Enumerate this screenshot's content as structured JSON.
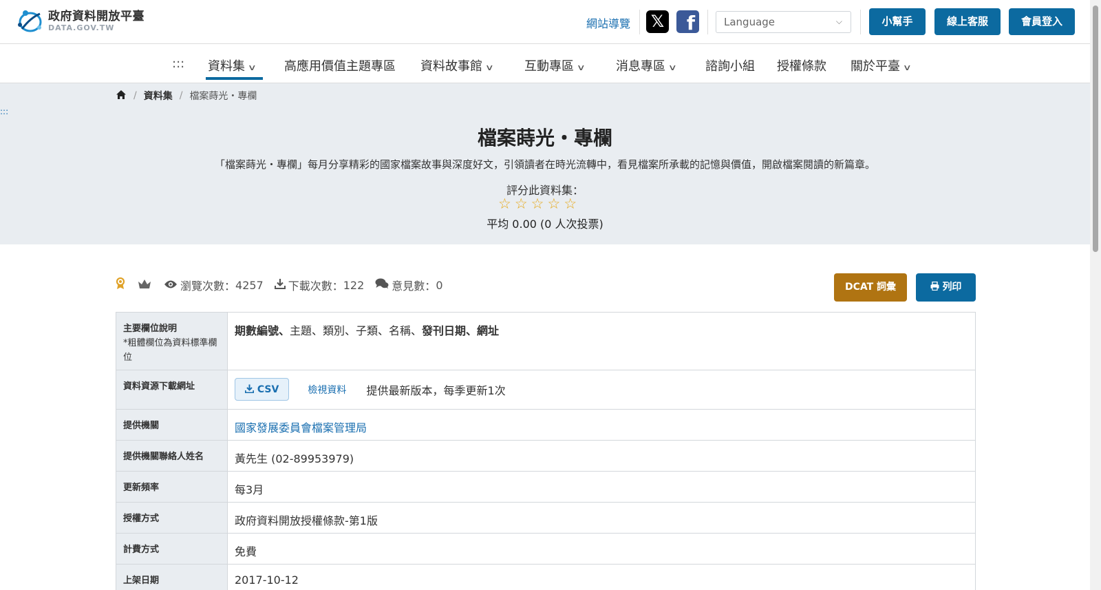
{
  "header": {
    "logo_title": "政府資料開放平臺",
    "logo_sub": "DATA.GOV.TW",
    "sitemap": "網站導覽",
    "x_glyph": "𝕏",
    "fb_glyph": "f",
    "language_placeholder": "Language",
    "buttons": [
      "小幫手",
      "線上客服",
      "會員登入"
    ],
    "accent": "#0c6aa0"
  },
  "nav": {
    "menu_glyph": ":::",
    "items": [
      {
        "label": "資料集",
        "dropdown": true,
        "active": true
      },
      {
        "label": "高應用價值主題專區",
        "dropdown": false
      },
      {
        "label": "資料故事館",
        "dropdown": true
      },
      {
        "label": "互動專區",
        "dropdown": true
      },
      {
        "label": "消息專區",
        "dropdown": true
      },
      {
        "label": "諮詢小組",
        "dropdown": false
      },
      {
        "label": "授權條款",
        "dropdown": false
      },
      {
        "label": "關於平臺",
        "dropdown": true
      }
    ]
  },
  "breadcrumb": {
    "level1": "資料集",
    "current": "檔案蒔光・專欄"
  },
  "skip_link": ":::",
  "dataset": {
    "title": "檔案蒔光・專欄",
    "description": "「檔案蒔光・專欄」每月分享精彩的國家檔案故事與深度好文，引領讀者在時光流轉中，看見檔案所承載的記憶與價值，開啟檔案閱讀的新篇章。",
    "rate_label": "評分此資料集：",
    "rating": 0,
    "rating_max": 5,
    "average_text": "平均 0.00 (0 人次投票)"
  },
  "stats": {
    "views_label": "瀏覽次數：",
    "views": "4257",
    "downloads_label": "下載次數：",
    "downloads": "122",
    "comments_label": "意見數：",
    "comments": "0"
  },
  "actions": {
    "dcat": "DCAT 詞彙",
    "print": "列印",
    "dcat_color": "#b07412"
  },
  "table": {
    "main_fields_label": "主要欄位說明",
    "main_fields_note": "*粗體欄位為資料標準欄位",
    "main_fields_bold1": "期數編號、",
    "main_fields_plain": "主題、類別、子類、名稱、",
    "main_fields_bold2": "發刊日期、網址",
    "download_label": "資料資源下載網址",
    "csv_label": "CSV",
    "view_label": "檢視資料",
    "download_note": "提供最新版本，每季更新1次",
    "agency_label": "提供機關",
    "agency_value": "國家發展委員會檔案管理局",
    "contact_label": "提供機關聯絡人姓名",
    "contact_value": "黃先生 (02-89953979)",
    "freq_label": "更新頻率",
    "freq_value": "每3月",
    "license_label": "授權方式",
    "license_value": "政府資料開放授權條款-第1版",
    "fee_label": "計費方式",
    "fee_value": "免費",
    "published_label": "上架日期",
    "published_value": "2017-10-12"
  }
}
